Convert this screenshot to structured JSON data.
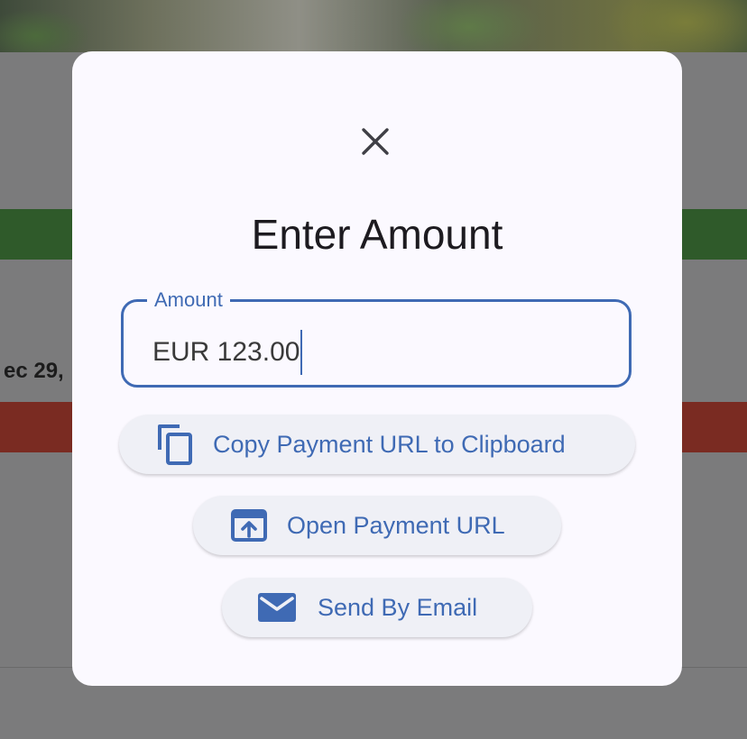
{
  "background": {
    "date_text": "ec 29,"
  },
  "dialog": {
    "close_icon": "close-icon",
    "title": "Enter Amount",
    "amount_field": {
      "label": "Amount",
      "value": "EUR 123.00"
    },
    "buttons": [
      {
        "icon": "copy-icon",
        "label": "Copy Payment URL to Clipboard"
      },
      {
        "icon": "open-in-browser-icon",
        "label": "Open Payment URL"
      },
      {
        "icon": "email-icon",
        "label": "Send By Email"
      }
    ]
  },
  "colors": {
    "accent": "#3f6ab4",
    "dialog_bg": "#fbf9ff",
    "button_bg": "#eff0f6",
    "scrim": "#7b7b7c",
    "bg_green": "#2f5a2a",
    "bg_red": "#7a2b22"
  }
}
